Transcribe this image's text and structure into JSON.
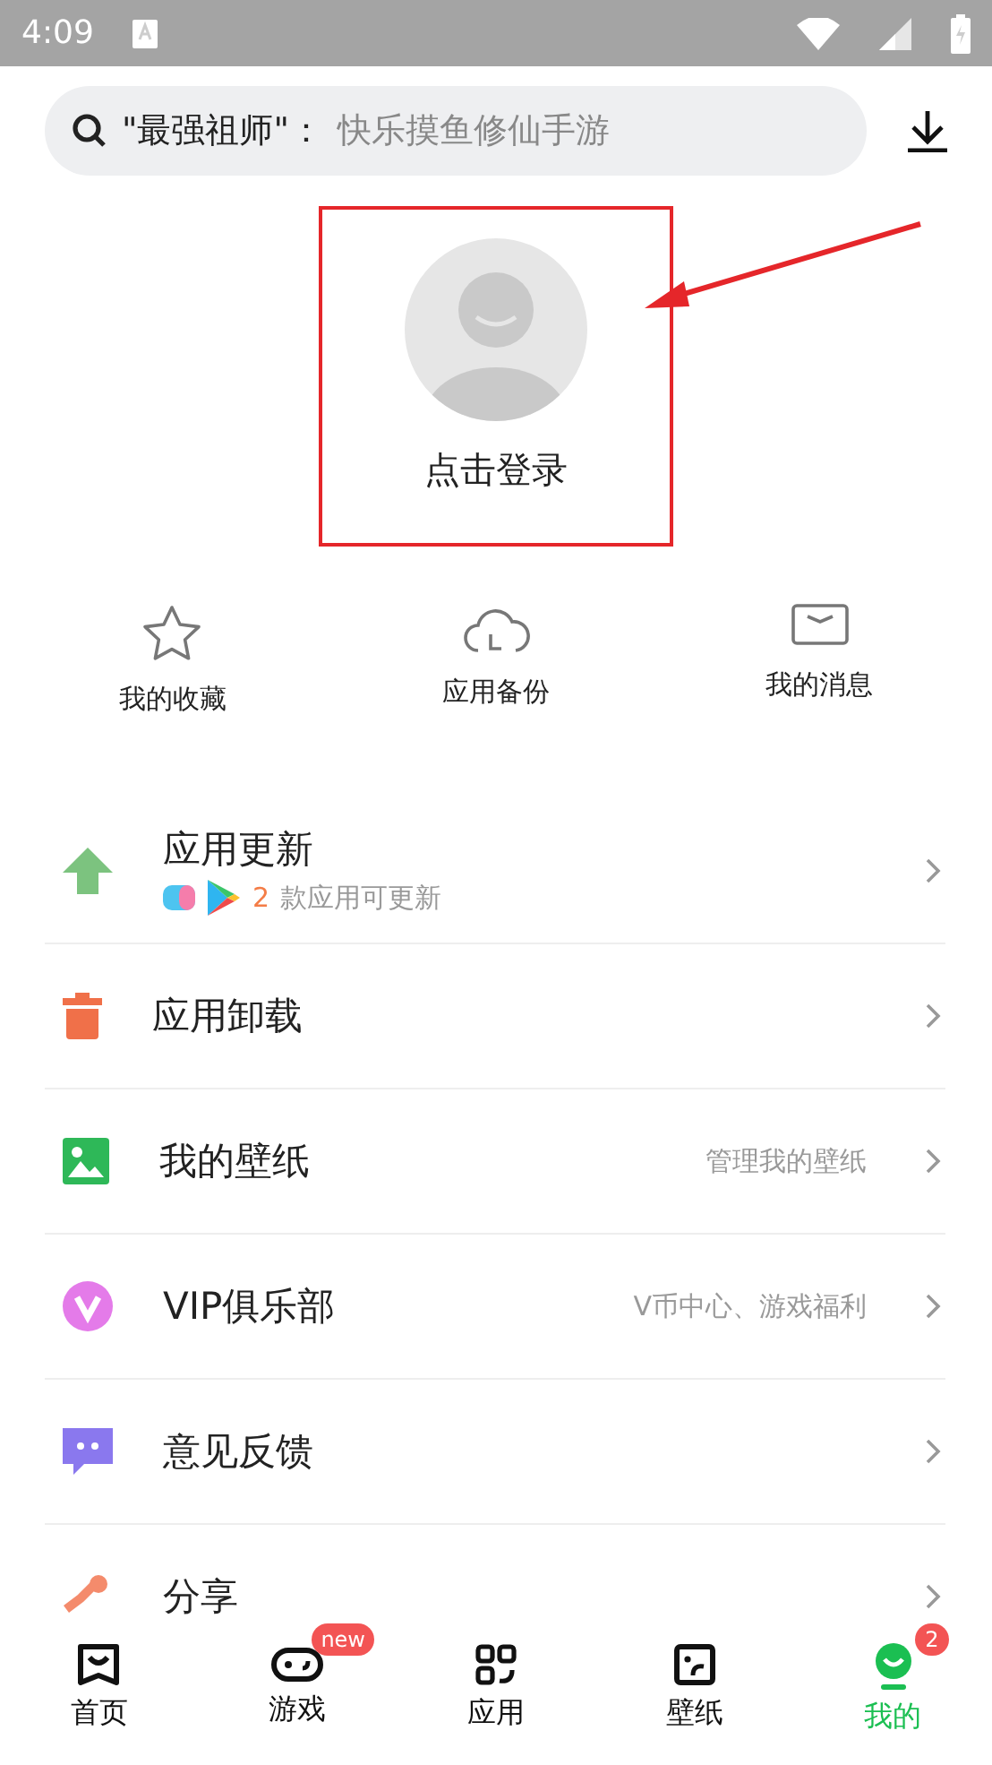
{
  "status_bar": {
    "time": "4:09"
  },
  "search": {
    "keyword": "\"最强祖师\"：",
    "placeholder": "快乐摸鱼修仙手游"
  },
  "profile": {
    "login_label": "点击登录"
  },
  "quick_actions": [
    "我的收藏",
    "应用备份",
    "我的消息"
  ],
  "menu": [
    {
      "title": "应用更新",
      "update_count": "2",
      "update_text": "款应用可更新"
    },
    {
      "title": "应用卸载"
    },
    {
      "title": "我的壁纸",
      "hint": "管理我的壁纸"
    },
    {
      "title": "VIP俱乐部",
      "hint": "V币中心、游戏福利"
    },
    {
      "title": "意见反馈"
    },
    {
      "title": "分享"
    }
  ],
  "tabs": [
    {
      "label": "首页",
      "selected": false
    },
    {
      "label": "游戏",
      "selected": false,
      "badge": "new"
    },
    {
      "label": "应用",
      "selected": false
    },
    {
      "label": "壁纸",
      "selected": false
    },
    {
      "label": "我的",
      "selected": true,
      "badge": "2"
    }
  ]
}
